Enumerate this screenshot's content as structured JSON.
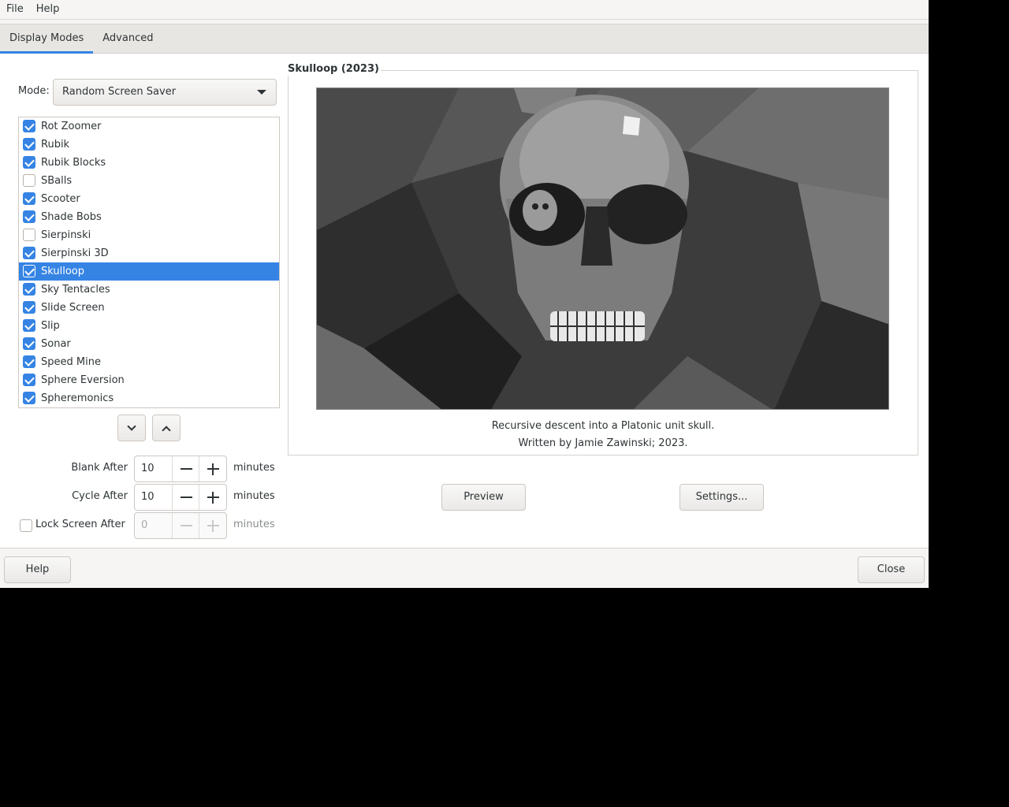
{
  "menubar": {
    "items": [
      "File",
      "Help"
    ]
  },
  "tabs": [
    {
      "label": "Display Modes",
      "active": true
    },
    {
      "label": "Advanced",
      "active": false
    }
  ],
  "mode": {
    "label": "Mode:",
    "value": "Random Screen Saver"
  },
  "savers": [
    {
      "name": "Rot Zoomer",
      "checked": true
    },
    {
      "name": "Rubik",
      "checked": true
    },
    {
      "name": "Rubik Blocks",
      "checked": true
    },
    {
      "name": "SBalls",
      "checked": false
    },
    {
      "name": "Scooter",
      "checked": true
    },
    {
      "name": "Shade Bobs",
      "checked": true
    },
    {
      "name": "Sierpinski",
      "checked": false
    },
    {
      "name": "Sierpinski 3D",
      "checked": true
    },
    {
      "name": "Skulloop",
      "checked": true,
      "selected": true
    },
    {
      "name": "Sky Tentacles",
      "checked": true
    },
    {
      "name": "Slide Screen",
      "checked": true
    },
    {
      "name": "Slip",
      "checked": true
    },
    {
      "name": "Sonar",
      "checked": true
    },
    {
      "name": "Speed Mine",
      "checked": true
    },
    {
      "name": "Sphere Eversion",
      "checked": true
    },
    {
      "name": "Spheremonics",
      "checked": true
    }
  ],
  "timing": {
    "blank": {
      "label": "Blank After",
      "value": "10",
      "unit": "minutes"
    },
    "cycle": {
      "label": "Cycle After",
      "value": "10",
      "unit": "minutes"
    },
    "lock": {
      "label": "Lock Screen After",
      "value": "0",
      "unit": "minutes",
      "checked": false
    }
  },
  "preview": {
    "title": "Skulloop (2023)",
    "description": "Recursive descent into a Platonic unit skull.",
    "credit": "Written by Jamie Zawinski; 2023.",
    "preview_label": "Preview",
    "settings_label": "Settings..."
  },
  "footer": {
    "help_label": "Help",
    "close_label": "Close"
  },
  "colors": {
    "accent": "#3584e4",
    "window_bg": "#f6f5f4"
  }
}
